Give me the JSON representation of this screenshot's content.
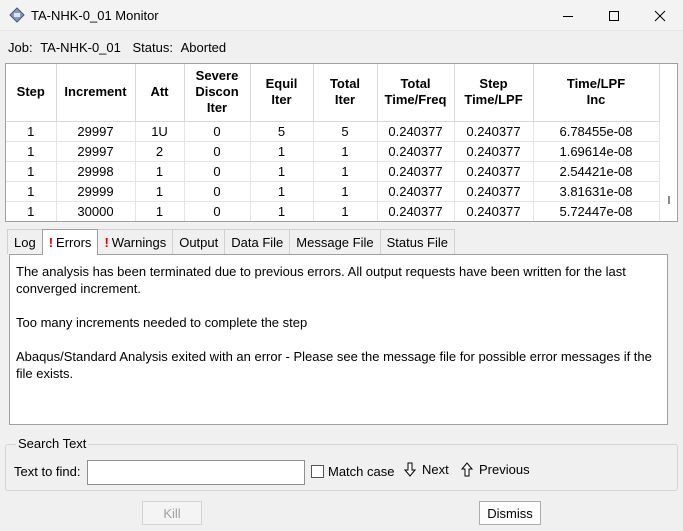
{
  "window": {
    "title": "TA-NHK-0_01 Monitor"
  },
  "job": {
    "job_label": "Job:",
    "job_name": "TA-NHK-0_01",
    "status_label": "Status:",
    "status_value": "Aborted"
  },
  "table": {
    "columns": [
      "Step",
      "Increment",
      "Att",
      "Severe\nDiscon\nIter",
      "Equil\nIter",
      "Total\nIter",
      "Total\nTime/Freq",
      "Step\nTime/LPF",
      "Time/LPF\nInc"
    ],
    "rows": [
      [
        "1",
        "29997",
        "1U",
        "0",
        "5",
        "5",
        "0.240377",
        "0.240377",
        "6.78455e-08"
      ],
      [
        "1",
        "29997",
        "2",
        "0",
        "1",
        "1",
        "0.240377",
        "0.240377",
        "1.69614e-08"
      ],
      [
        "1",
        "29998",
        "1",
        "0",
        "1",
        "1",
        "0.240377",
        "0.240377",
        "2.54421e-08"
      ],
      [
        "1",
        "29999",
        "1",
        "0",
        "1",
        "1",
        "0.240377",
        "0.240377",
        "3.81631e-08"
      ],
      [
        "1",
        "30000",
        "1",
        "0",
        "1",
        "1",
        "0.240377",
        "0.240377",
        "5.72447e-08"
      ]
    ]
  },
  "tabs": [
    {
      "label": "Log",
      "flag": ""
    },
    {
      "label": "Errors",
      "flag": "!"
    },
    {
      "label": "Warnings",
      "flag": "!"
    },
    {
      "label": "Output",
      "flag": ""
    },
    {
      "label": "Data File",
      "flag": ""
    },
    {
      "label": "Message File",
      "flag": ""
    },
    {
      "label": "Status File",
      "flag": ""
    }
  ],
  "active_tab": "Errors",
  "messages": [
    "The analysis has been terminated due to previous errors. All output requests have been written for the last converged increment.",
    "Too many increments needed to complete the step",
    "Abaqus/Standard Analysis exited with an error - Please see the  message file for possible error messages if the file exists."
  ],
  "search": {
    "group_title": "Search Text",
    "find_label": "Text to find:",
    "find_value": "",
    "match_case_label": "Match case",
    "match_case_checked": false,
    "next_label": "Next",
    "previous_label": "Previous"
  },
  "buttons": {
    "kill_label": "Kill",
    "kill_enabled": false,
    "dismiss_label": "Dismiss"
  },
  "colors": {
    "error_flag": "#e00000",
    "background": "#f0f0f0"
  },
  "icons": {
    "app": "abaqus-monitor-icon",
    "next": "arrow-down-icon",
    "previous": "arrow-up-icon"
  }
}
